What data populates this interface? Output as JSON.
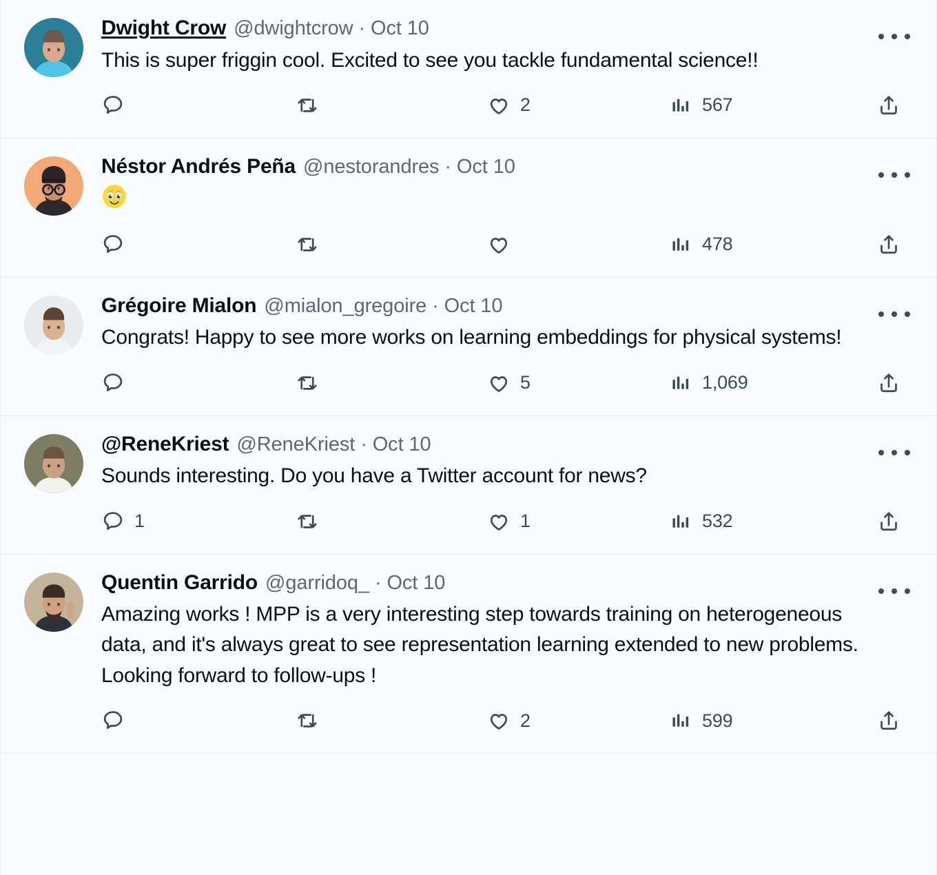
{
  "app": {
    "platform": "twitter-thread",
    "accent_color": "#1d9bf0",
    "text_color": "#0b0e13",
    "muted_color": "#5d6874",
    "icon_color": "#3a4a5c",
    "background": "#fafbfc",
    "divider_color": "#eaedee"
  },
  "icons": {
    "reply": "reply-icon",
    "retweet": "retweet-icon",
    "like": "heart-icon",
    "views": "analytics-bars-icon",
    "share": "share-icon",
    "more": "more-options-icon"
  },
  "tweets": [
    {
      "display_name": "Dwight Crow",
      "name_underlined": true,
      "handle": "@dwightcrow",
      "separator": "·",
      "date": "Oct 10",
      "handle_meta": "@dwightcrow · Oct 10",
      "text": "This is super friggin cool. Excited to see you tackle fundamental science!!",
      "emoji": "",
      "avatar": {
        "name": "avatar-dwight-crow",
        "bg": "#2b7f96",
        "skin": "#d8a98c",
        "shirt": "#4fc3e8",
        "hair": "#6d5a4a"
      },
      "actions": {
        "reply_count": "",
        "retweet_count": "",
        "like_count": "2",
        "views_count": "567",
        "share_count": ""
      }
    },
    {
      "display_name": "Néstor Andrés Peña",
      "name_underlined": false,
      "handle": "@nestorandres",
      "separator": "·",
      "date": "Oct 10",
      "handle_meta": "@nestorandres · Oct 10",
      "text": "",
      "emoji": "face-holding-back-tears",
      "avatar": {
        "name": "avatar-nestor-andres-pena",
        "bg": "#f3a878",
        "skin": "#c98f6e",
        "shirt": "#2c2a2e",
        "hair": "#241f1d"
      },
      "actions": {
        "reply_count": "",
        "retweet_count": "",
        "like_count": "",
        "views_count": "478",
        "share_count": ""
      }
    },
    {
      "display_name": "Grégoire Mialon",
      "name_underlined": false,
      "handle": "@mialon_gregoire",
      "separator": "·",
      "date": "Oct 10",
      "handle_meta": "@mialon_gregoire · Oct 10",
      "text": "Congrats! Happy to see more works on learning embeddings for physical systems!",
      "emoji": "",
      "avatar": {
        "name": "avatar-gregoire-mialon",
        "bg": "#e8ecef",
        "skin": "#d9b191",
        "shirt": "#f2f4f6",
        "hair": "#5a4434"
      },
      "actions": {
        "reply_count": "",
        "retweet_count": "",
        "like_count": "5",
        "views_count": "1,069",
        "share_count": ""
      }
    },
    {
      "display_name": "@ReneKriest",
      "name_underlined": false,
      "handle": "@ReneKriest",
      "separator": "·",
      "date": "Oct 10",
      "handle_meta": "@ReneKriest · Oct 10",
      "text": "Sounds interesting. Do you have a Twitter account for news?",
      "emoji": "",
      "avatar": {
        "name": "avatar-rene-kriest",
        "bg": "#7d7d63",
        "skin": "#caa184",
        "shirt": "#f3f1ec",
        "hair": "#6b5440"
      },
      "actions": {
        "reply_count": "1",
        "retweet_count": "",
        "like_count": "1",
        "views_count": "532",
        "share_count": ""
      }
    },
    {
      "display_name": "Quentin Garrido",
      "name_underlined": false,
      "handle": "@garridoq_",
      "separator": "·",
      "date": "Oct 10",
      "handle_meta": "@garridoq_ · Oct 10",
      "text": "Amazing works ! MPP is a very interesting step towards training on heterogeneous data, and it's always great to see representation learning extended to new problems. Looking forward to follow-ups !",
      "emoji": "",
      "avatar": {
        "name": "avatar-quentin-garrido",
        "bg": "#c4b49a",
        "skin": "#cfa182",
        "shirt": "#2e3138",
        "hair": "#3a2d23"
      },
      "actions": {
        "reply_count": "",
        "retweet_count": "",
        "like_count": "2",
        "views_count": "599",
        "share_count": ""
      }
    }
  ]
}
